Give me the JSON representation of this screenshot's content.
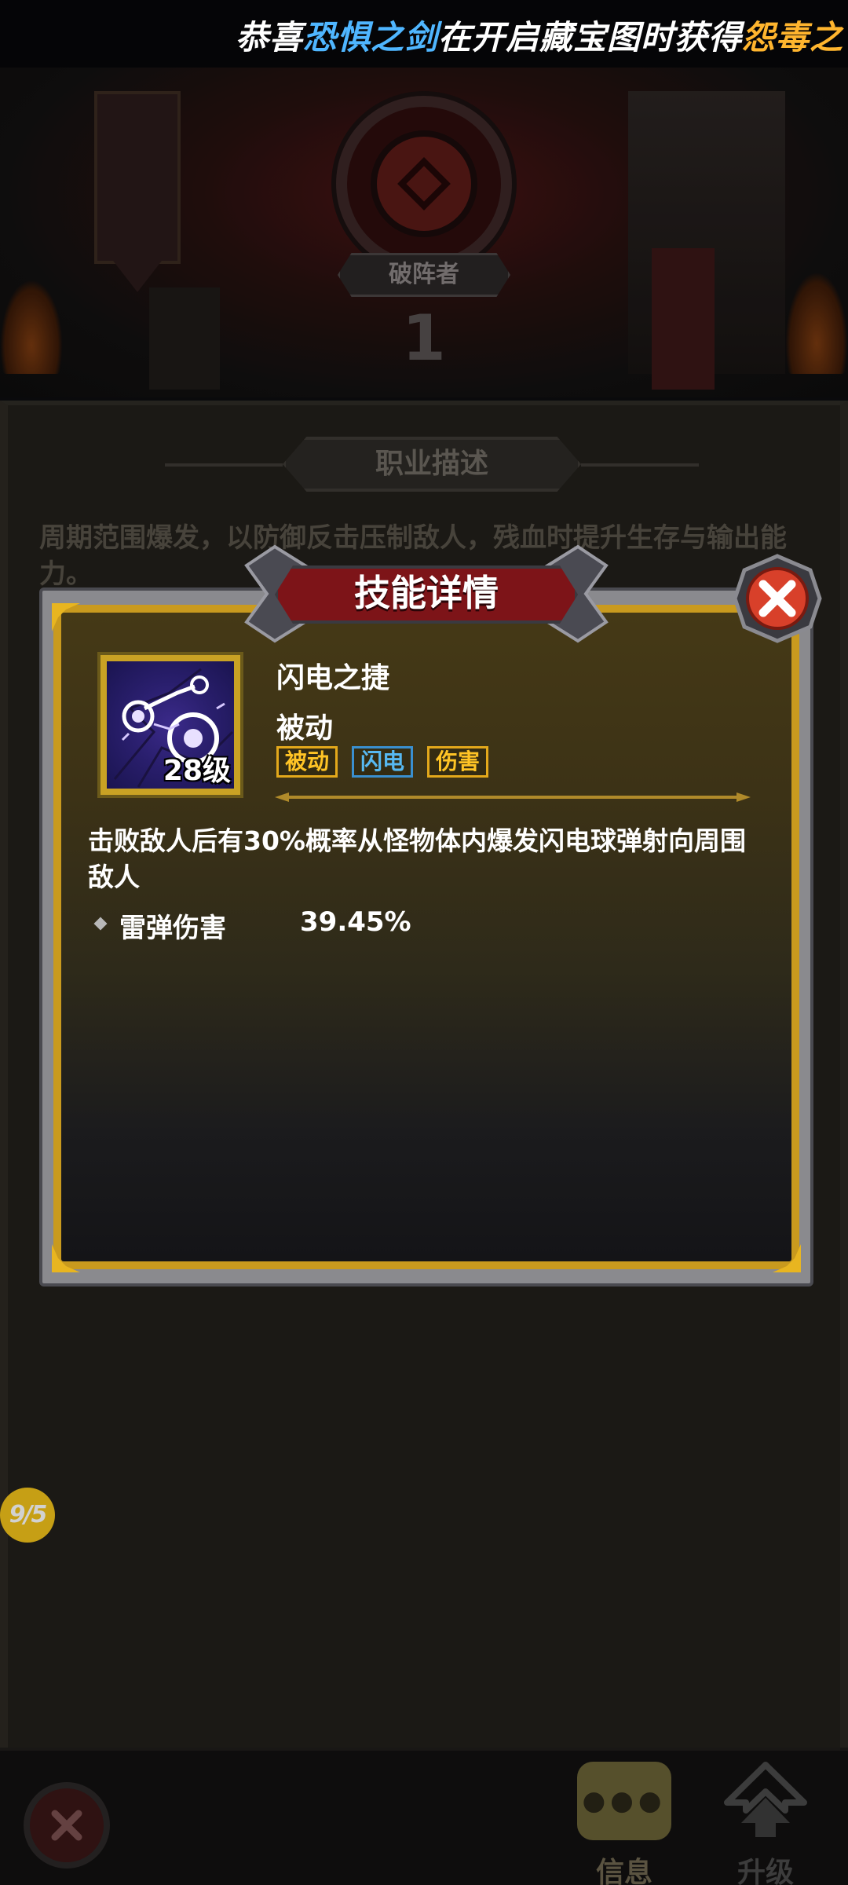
{
  "marquee": {
    "part1": "恭喜",
    "player": "恐惧之剑",
    "part2": "在开启藏宝图时获得",
    "item": "怨毒之"
  },
  "hero": {
    "class_name": "破阵者",
    "rank": "1"
  },
  "panel": {
    "section_title": "职业描述",
    "class_description": "周期范围爆发，以防御反击压制敌人，残血时提升生存与输出能力。"
  },
  "dialog": {
    "title": "技能详情",
    "skill_name": "闪电之捷",
    "skill_type": "被动",
    "skill_level": "28级",
    "tags": [
      "被动",
      "闪电",
      "伤害"
    ],
    "description": "击败敌人后有30%概率从怪物体内爆发闪电球弹射向周围敌人",
    "stat_label": "雷弹伤害",
    "stat_value": "39.45%"
  },
  "page_badge": "9/5",
  "bottom_nav": {
    "info_label": "信息",
    "upgrade_label": "升级"
  },
  "colors": {
    "accent_gold": "#c99a1e",
    "title_red": "#7d1418",
    "tag_gold": "#ffc425",
    "tag_blue": "#57b8f0",
    "marquee_blue": "#4fb6ff",
    "marquee_orange": "#ffb52e"
  },
  "icons": [
    "close-icon",
    "lightning-skill-icon",
    "chat-bubble-icon",
    "upgrade-arrow-icon"
  ]
}
